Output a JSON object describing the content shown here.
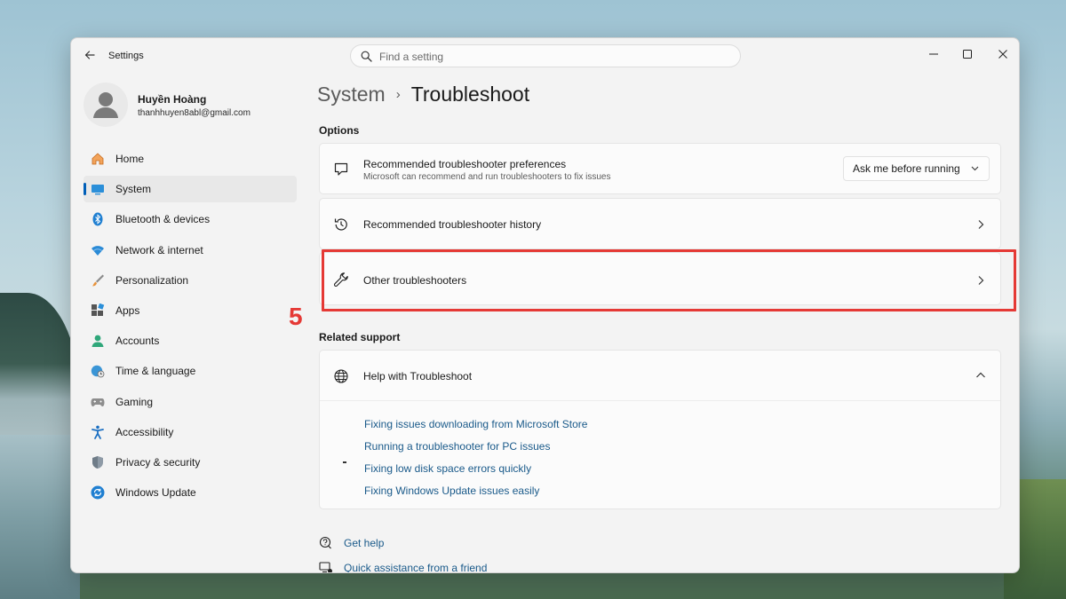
{
  "window": {
    "app_title": "Settings",
    "search_placeholder": "Find a setting"
  },
  "profile": {
    "name": "Huyền Hoàng",
    "email": "thanhhuyen8abl@gmail.com"
  },
  "sidebar": {
    "items": [
      {
        "label": "Home",
        "icon": "home-icon"
      },
      {
        "label": "System",
        "icon": "system-icon",
        "selected": true
      },
      {
        "label": "Bluetooth & devices",
        "icon": "bluetooth-icon"
      },
      {
        "label": "Network & internet",
        "icon": "wifi-icon"
      },
      {
        "label": "Personalization",
        "icon": "brush-icon"
      },
      {
        "label": "Apps",
        "icon": "apps-icon"
      },
      {
        "label": "Accounts",
        "icon": "accounts-icon"
      },
      {
        "label": "Time & language",
        "icon": "globe-clock-icon"
      },
      {
        "label": "Gaming",
        "icon": "gamepad-icon"
      },
      {
        "label": "Accessibility",
        "icon": "accessibility-icon"
      },
      {
        "label": "Privacy & security",
        "icon": "shield-icon"
      },
      {
        "label": "Windows Update",
        "icon": "update-icon"
      }
    ]
  },
  "breadcrumb": {
    "parent": "System",
    "separator": "›",
    "current": "Troubleshoot"
  },
  "options": {
    "label": "Options",
    "preferences": {
      "title": "Recommended troubleshooter preferences",
      "subtitle": "Microsoft can recommend and run troubleshooters to fix issues",
      "dropdown_value": "Ask me before running"
    },
    "history": {
      "title": "Recommended troubleshooter history"
    },
    "other": {
      "title": "Other troubleshooters"
    }
  },
  "annotation": {
    "step": "5",
    "color": "#e53935"
  },
  "related": {
    "label": "Related support",
    "help_title": "Help with Troubleshoot",
    "links": [
      "Fixing issues downloading from Microsoft Store",
      "Running a troubleshooter for PC issues",
      "Fixing low disk space errors quickly",
      "Fixing Windows Update issues easily"
    ]
  },
  "bottom_links": {
    "get_help": "Get help",
    "quick_assist": "Quick assistance from a friend"
  },
  "colors": {
    "accent": "#005fb8",
    "link": "#1a5a8a"
  }
}
